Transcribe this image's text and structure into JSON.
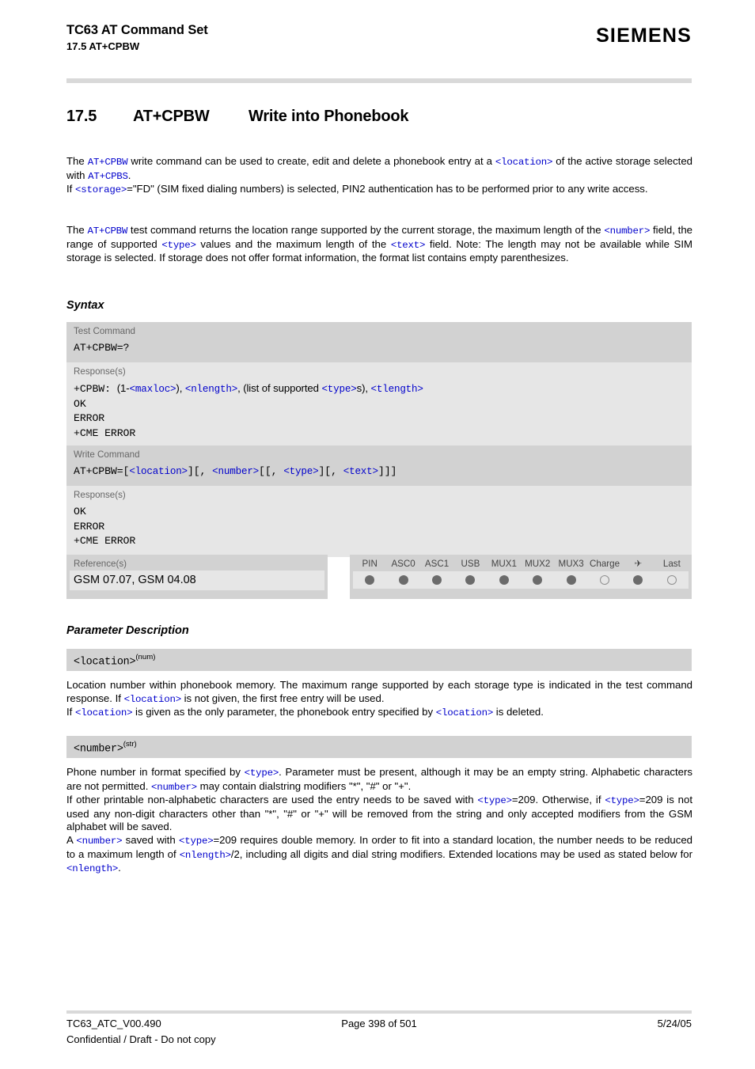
{
  "header": {
    "title": "TC63 AT Command Set",
    "subtitle": "17.5 AT+CPBW",
    "logo": "SIEMENS"
  },
  "section": {
    "number": "17.5",
    "command": "AT+CPBW",
    "title": "Write into Phonebook"
  },
  "intro": {
    "p1_a": "The ",
    "p1_tok1": "AT+CPBW",
    "p1_b": " write command can be used to create, edit and delete a phonebook entry at a ",
    "p1_tok2": "<location>",
    "p1_c": " of the active storage selected with ",
    "p1_tok3": "AT+CPBS",
    "p1_d": ".",
    "p1_e": "If ",
    "p1_tok4": "<storage>",
    "p1_f": "=\"FD\" (SIM fixed dialing numbers) is selected, PIN2 authentication has to be performed prior to any write access.",
    "p2_a": "The ",
    "p2_tok1": "AT+CPBW",
    "p2_b": " test command returns the location range supported by the current storage, the maximum length of the ",
    "p2_tok2": "<number>",
    "p2_c": " field, the range of supported ",
    "p2_tok3": "<type>",
    "p2_d": " values and the maximum length of the ",
    "p2_tok4": "<text>",
    "p2_e": " field. Note: The length may not be available while SIM storage is selected. If storage does not offer format information, the format list contains empty parenthesizes."
  },
  "headings": {
    "syntax": "Syntax",
    "parameter_description": "Parameter Description"
  },
  "test_command": {
    "label": "Test Command",
    "syntax": "AT+CPBW=?",
    "response_label": "Response(s)",
    "resp_prefix": "+CPBW:",
    "resp_open": "(1-",
    "resp_tok1": "<maxloc>",
    "resp_mid1": "), ",
    "resp_tok2": "<nlength>",
    "resp_mid2": ", (list of supported ",
    "resp_tok3": "<type>",
    "resp_mid3": "s), ",
    "resp_tok4": "<tlength>",
    "lines": [
      "OK",
      "ERROR",
      "+CME ERROR"
    ]
  },
  "write_command": {
    "label": "Write Command",
    "syn_a": "AT+CPBW=[",
    "syn_tok1": "<location>",
    "syn_b": "][, ",
    "syn_tok2": "<number>",
    "syn_c": "[[, ",
    "syn_tok3": "<type>",
    "syn_d": "][, ",
    "syn_tok4": "<text>",
    "syn_e": "]]]",
    "response_label": "Response(s)",
    "lines": [
      "OK",
      "ERROR",
      "+CME ERROR"
    ]
  },
  "reference": {
    "label": "Reference(s)",
    "value": "GSM 07.07, GSM 04.08"
  },
  "capabilities": {
    "columns": [
      {
        "label": "PIN",
        "state": "filled"
      },
      {
        "label": "ASC0",
        "state": "filled"
      },
      {
        "label": "ASC1",
        "state": "filled"
      },
      {
        "label": "USB",
        "state": "filled"
      },
      {
        "label": "MUX1",
        "state": "filled"
      },
      {
        "label": "MUX2",
        "state": "filled"
      },
      {
        "label": "MUX3",
        "state": "filled"
      },
      {
        "label": "Charge",
        "state": "hollow"
      },
      {
        "label": "✈",
        "state": "filled"
      },
      {
        "label": "Last",
        "state": "hollow"
      }
    ]
  },
  "params": {
    "location": {
      "name": "<location>",
      "type": "(num)",
      "l1": "Location number within phonebook memory. The maximum range supported by each storage type is indicated in the test command response. If ",
      "tok1": "<location>",
      "l2": " is not given, the first free entry will be used.",
      "l3": "If ",
      "tok2": "<location>",
      "l4": " is given as the only parameter, the phonebook entry specified by ",
      "tok3": "<location>",
      "l5": " is deleted."
    },
    "number": {
      "name": "<number>",
      "type": "(str)",
      "l1": "Phone number in format specified by ",
      "tok1": "<type>",
      "l2": ". Parameter must be present, although it may be an empty string. Alphabetic characters are not permitted. ",
      "tok2": "<number>",
      "l3": " may contain dialstring modifiers \"*\", \"#\" or \"+\".",
      "l4": "If other printable non-alphabetic characters are used the entry needs to be saved with ",
      "tok3": "<type>",
      "l5": "=209. Otherwise, if ",
      "tok4": "<type>",
      "l6": "=209 is not used any non-digit characters other than \"*\", \"#\" or \"+\" will be removed from the string and only accepted modifiers from the GSM alphabet will be saved.",
      "l7": "A ",
      "tok5": "<number>",
      "l8": " saved with ",
      "tok6": "<type>",
      "l9": "=209 requires double memory. In order to fit into a standard location, the number needs to be reduced to a maximum length of ",
      "tok7": "<nlength>",
      "l10": "/2, including all digits and dial string modifiers. Extended locations may be used as stated below for ",
      "tok8": "<nlength>",
      "l11": "."
    }
  },
  "footer": {
    "document": "TC63_ATC_V00.490",
    "page": "Page 398 of 501",
    "date": "5/24/05",
    "confidential": "Confidential / Draft - Do not copy"
  }
}
